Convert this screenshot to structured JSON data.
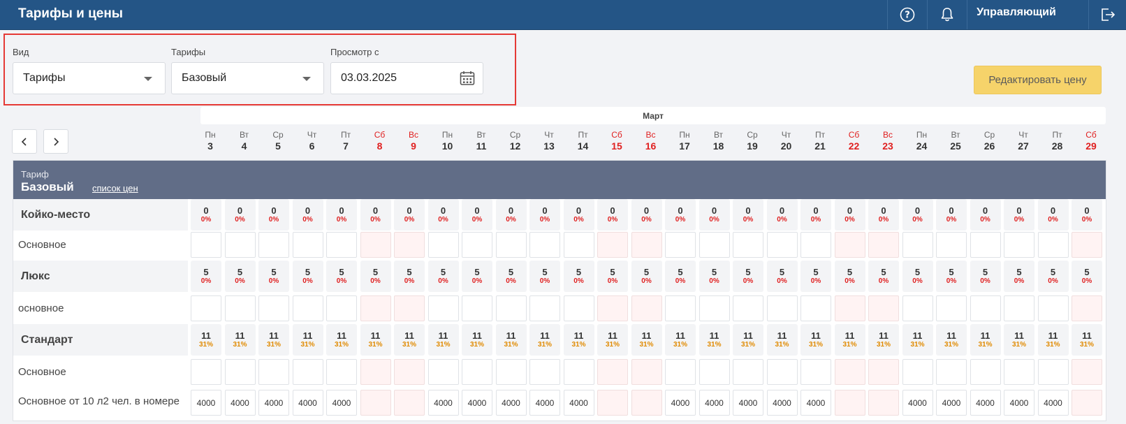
{
  "header": {
    "title": "Тарифы и цены",
    "user_label": "Управляющий",
    "icons": [
      "help-icon",
      "bell-icon",
      "logout-icon"
    ]
  },
  "filters": {
    "view": {
      "label": "Вид",
      "value": "Тарифы"
    },
    "tariffs": {
      "label": "Тарифы",
      "value": "Базовый"
    },
    "date": {
      "label": "Просмотр с",
      "value": "03.03.2025"
    }
  },
  "edit_button": "Редактировать цену",
  "month": "Март",
  "days": [
    {
      "dow": "Пн",
      "num": "3",
      "weekend": false
    },
    {
      "dow": "Вт",
      "num": "4",
      "weekend": false
    },
    {
      "dow": "Ср",
      "num": "5",
      "weekend": false
    },
    {
      "dow": "Чт",
      "num": "6",
      "weekend": false
    },
    {
      "dow": "Пт",
      "num": "7",
      "weekend": false
    },
    {
      "dow": "Сб",
      "num": "8",
      "weekend": true
    },
    {
      "dow": "Вс",
      "num": "9",
      "weekend": true
    },
    {
      "dow": "Пн",
      "num": "10",
      "weekend": false
    },
    {
      "dow": "Вт",
      "num": "11",
      "weekend": false
    },
    {
      "dow": "Ср",
      "num": "12",
      "weekend": false
    },
    {
      "dow": "Чт",
      "num": "13",
      "weekend": false
    },
    {
      "dow": "Пт",
      "num": "14",
      "weekend": false
    },
    {
      "dow": "Сб",
      "num": "15",
      "weekend": true
    },
    {
      "dow": "Вс",
      "num": "16",
      "weekend": true
    },
    {
      "dow": "Пн",
      "num": "17",
      "weekend": false
    },
    {
      "dow": "Вт",
      "num": "18",
      "weekend": false
    },
    {
      "dow": "Ср",
      "num": "19",
      "weekend": false
    },
    {
      "dow": "Чт",
      "num": "20",
      "weekend": false
    },
    {
      "dow": "Пт",
      "num": "21",
      "weekend": false
    },
    {
      "dow": "Сб",
      "num": "22",
      "weekend": true
    },
    {
      "dow": "Вс",
      "num": "23",
      "weekend": true
    },
    {
      "dow": "Пн",
      "num": "24",
      "weekend": false
    },
    {
      "dow": "Вт",
      "num": "25",
      "weekend": false
    },
    {
      "dow": "Ср",
      "num": "26",
      "weekend": false
    },
    {
      "dow": "Чт",
      "num": "27",
      "weekend": false
    },
    {
      "dow": "Пт",
      "num": "28",
      "weekend": false
    },
    {
      "dow": "Сб",
      "num": "29",
      "weekend": true
    }
  ],
  "tariff": {
    "label": "Тариф",
    "name": "Базовый",
    "price_list_link": "список цен"
  },
  "rows": [
    {
      "kind": "category",
      "label": "Койко-место",
      "count": "0",
      "percent": "0%",
      "percent_color": "#e02020"
    },
    {
      "kind": "price",
      "label": "Основное",
      "values": [
        "",
        "",
        "",
        "",
        "",
        "",
        "",
        "",
        "",
        "",
        "",
        "",
        "",
        "",
        "",
        "",
        "",
        "",
        "",
        "",
        "",
        "",
        "",
        "",
        "",
        "",
        ""
      ]
    },
    {
      "kind": "category",
      "label": "Люкс",
      "count": "5",
      "percent": "0%",
      "percent_color": "#e02020"
    },
    {
      "kind": "price",
      "label": "основное",
      "values": [
        "",
        "",
        "",
        "",
        "",
        "",
        "",
        "",
        "",
        "",
        "",
        "",
        "",
        "",
        "",
        "",
        "",
        "",
        "",
        "",
        "",
        "",
        "",
        "",
        "",
        "",
        ""
      ]
    },
    {
      "kind": "category",
      "label": "Стандарт",
      "count": "11",
      "percent": "31%",
      "percent_color": "#e08a00"
    },
    {
      "kind": "price",
      "label": "Основное",
      "values": [
        "",
        "",
        "",
        "",
        "",
        "",
        "",
        "",
        "",
        "",
        "",
        "",
        "",
        "",
        "",
        "",
        "",
        "",
        "",
        "",
        "",
        "",
        "",
        "",
        "",
        "",
        ""
      ]
    },
    {
      "kind": "price",
      "label": "Основное от 10 л2 чел. в номере",
      "values": [
        "4000",
        "4000",
        "4000",
        "4000",
        "4000",
        "",
        "",
        "4000",
        "4000",
        "4000",
        "4000",
        "4000",
        "",
        "",
        "4000",
        "4000",
        "4000",
        "4000",
        "4000",
        "",
        "",
        "4000",
        "4000",
        "4000",
        "4000",
        "4000",
        ""
      ]
    }
  ]
}
